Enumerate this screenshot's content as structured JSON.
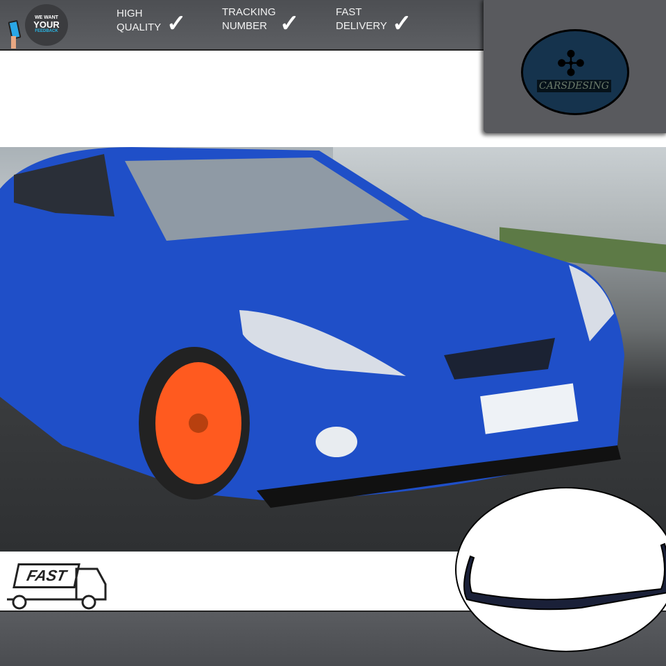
{
  "header": {
    "feedback": {
      "line1": "WE WANT",
      "line2": "YOUR",
      "line3": "FEEDBACK"
    },
    "features": [
      {
        "line1": "HIGH",
        "line2": "QUALITY",
        "icon": "check-icon"
      },
      {
        "line1": "TRACKING",
        "line2": "NUMBER",
        "icon": "check-icon"
      },
      {
        "line1": "FAST",
        "line2": "DELIVERY",
        "icon": "check-icon"
      }
    ],
    "check": "✓"
  },
  "brand": {
    "name": "CARSDESING"
  },
  "footer": {
    "fast_label": "FAST"
  },
  "colors": {
    "bar": "#55575b",
    "logo_bg": "#15334d",
    "car_blue": "#1f4fc8",
    "wheel": "#ff5a1f",
    "feedback_accent": "#2ab7e6"
  }
}
